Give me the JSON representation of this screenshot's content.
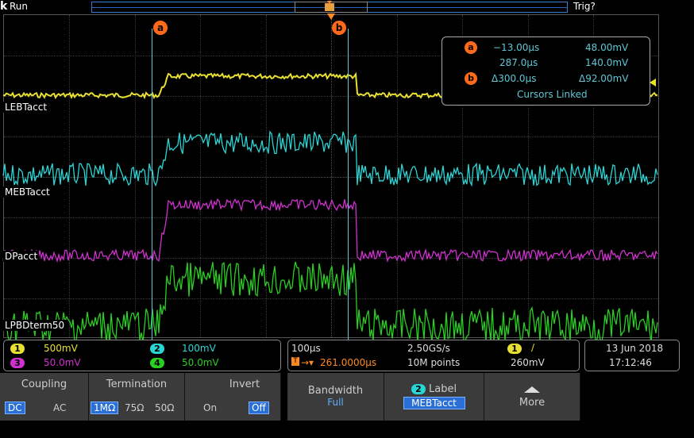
{
  "status": {
    "logo": "k",
    "run": "Run",
    "trigger_state": "Trig?"
  },
  "cursors": {
    "a_label": "a",
    "b_label": "b"
  },
  "readout": {
    "a_time": "−13.00μs",
    "a_volt": "48.00mV",
    "b_time": "287.0μs",
    "b_volt": "140.0mV",
    "delta_time": "Δ300.0μs",
    "delta_volt": "Δ92.00mV",
    "linked": "Cursors Linked"
  },
  "traces": [
    {
      "name": "LEBTacct",
      "color": "#e8e030"
    },
    {
      "name": "MEBTacct",
      "color": "#28d6d6"
    },
    {
      "name": "DPacct",
      "color": "#d030d0"
    },
    {
      "name": "LPBDterm50",
      "color": "#28d020"
    }
  ],
  "channels": {
    "ch1": {
      "num": "1",
      "scale": "500mV",
      "color": "#e8e030"
    },
    "ch2": {
      "num": "2",
      "scale": "100mV",
      "color": "#28d6d6"
    },
    "ch3": {
      "num": "3",
      "scale": "50.0mV",
      "color": "#d030d0"
    },
    "ch4": {
      "num": "4",
      "scale": "50.0mV",
      "color": "#28d020"
    }
  },
  "timebase": {
    "horiz": "100μs",
    "sample_rate": "2.50GS/s",
    "delay": "261.0000μs",
    "points": "10M points",
    "trig_ch": "1",
    "trig_level": "260mV"
  },
  "datetime": {
    "date": "13 Jun  2018",
    "time": "17:12:46"
  },
  "menu": {
    "coupling": {
      "title": "Coupling",
      "opts": [
        "DC",
        "AC"
      ]
    },
    "termination": {
      "title": "Termination",
      "opts": [
        "1MΩ",
        "75Ω",
        "50Ω"
      ]
    },
    "invert": {
      "title": "Invert",
      "opts": [
        "On",
        "Off"
      ]
    },
    "bandwidth": {
      "title": "Bandwidth",
      "value": "Full"
    },
    "label": {
      "badge": "2",
      "title": "Label",
      "value": "MEBTacct"
    },
    "more": {
      "title": "More"
    }
  }
}
